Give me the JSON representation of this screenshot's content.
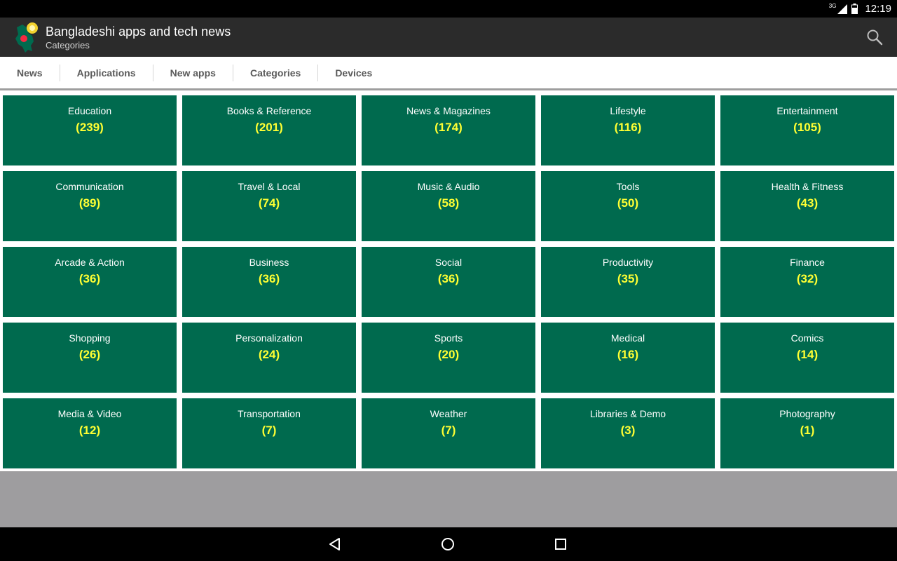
{
  "status_bar": {
    "network": "3G",
    "time": "12:19"
  },
  "header": {
    "title": "Bangladeshi apps and tech news",
    "subtitle": "Categories",
    "search_icon": "search-icon",
    "logo_icon": "bangladesh-map-logo",
    "colors": {
      "flag_green": "#006a4e",
      "flag_red": "#f42a41"
    }
  },
  "tabs": [
    {
      "label": "News"
    },
    {
      "label": "Applications"
    },
    {
      "label": "New apps"
    },
    {
      "label": "Categories"
    },
    {
      "label": "Devices"
    }
  ],
  "categories": [
    {
      "name": "Education",
      "count": "(239)"
    },
    {
      "name": "Books & Reference",
      "count": "(201)"
    },
    {
      "name": "News & Magazines",
      "count": "(174)"
    },
    {
      "name": "Lifestyle",
      "count": "(116)"
    },
    {
      "name": "Entertainment",
      "count": "(105)"
    },
    {
      "name": "Communication",
      "count": "(89)"
    },
    {
      "name": "Travel & Local",
      "count": "(74)"
    },
    {
      "name": "Music & Audio",
      "count": "(58)"
    },
    {
      "name": "Tools",
      "count": "(50)"
    },
    {
      "name": "Health & Fitness",
      "count": "(43)"
    },
    {
      "name": "Arcade & Action",
      "count": "(36)"
    },
    {
      "name": "Business",
      "count": "(36)"
    },
    {
      "name": "Social",
      "count": "(36)"
    },
    {
      "name": "Productivity",
      "count": "(35)"
    },
    {
      "name": "Finance",
      "count": "(32)"
    },
    {
      "name": "Shopping",
      "count": "(26)"
    },
    {
      "name": "Personalization",
      "count": "(24)"
    },
    {
      "name": "Sports",
      "count": "(20)"
    },
    {
      "name": "Medical",
      "count": "(16)"
    },
    {
      "name": "Comics",
      "count": "(14)"
    },
    {
      "name": "Media & Video",
      "count": "(12)"
    },
    {
      "name": "Transportation",
      "count": "(7)"
    },
    {
      "name": "Weather",
      "count": "(7)"
    },
    {
      "name": "Libraries & Demo",
      "count": "(3)"
    },
    {
      "name": "Photography",
      "count": "(1)"
    }
  ],
  "colors": {
    "tile_background": "#006a4e",
    "count_text": "#ffff33",
    "action_bar": "#2b2b2b"
  },
  "nav_bar": {
    "icons": [
      "back-icon",
      "home-icon",
      "recents-icon"
    ]
  }
}
